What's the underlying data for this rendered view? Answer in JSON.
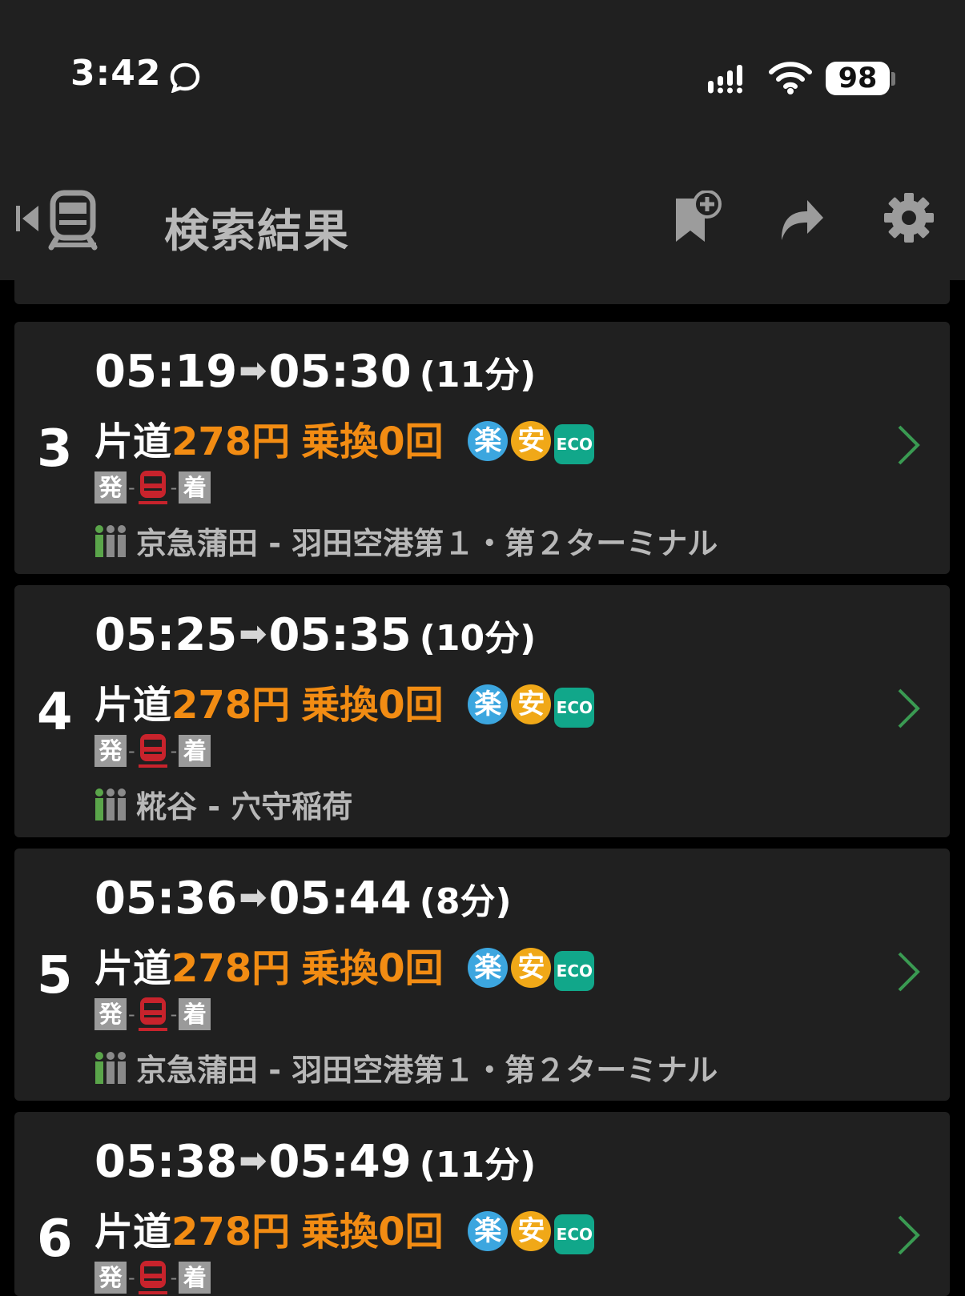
{
  "status_bar": {
    "time": "3:42",
    "battery": "98"
  },
  "header": {
    "title": "検索結果"
  },
  "routes": [
    {
      "number": "3",
      "depart": "05:19",
      "arrive": "05:30",
      "duration": "(11分)",
      "fare_label": "片道",
      "fare": "278円",
      "transfers": "乗換0回",
      "badge_raku": "楽",
      "badge_an": "安",
      "badge_eco": "ECO",
      "leg_depart": "発",
      "leg_arrive": "着",
      "line": "京急蒲田 - 羽田空港第１・第２ターミナル"
    },
    {
      "number": "4",
      "depart": "05:25",
      "arrive": "05:35",
      "duration": "(10分)",
      "fare_label": "片道",
      "fare": "278円",
      "transfers": "乗換0回",
      "badge_raku": "楽",
      "badge_an": "安",
      "badge_eco": "ECO",
      "leg_depart": "発",
      "leg_arrive": "着",
      "line": "糀谷 - 穴守稲荷"
    },
    {
      "number": "5",
      "depart": "05:36",
      "arrive": "05:44",
      "duration": "(8分)",
      "fare_label": "片道",
      "fare": "278円",
      "transfers": "乗換0回",
      "badge_raku": "楽",
      "badge_an": "安",
      "badge_eco": "ECO",
      "leg_depart": "発",
      "leg_arrive": "着",
      "line": "京急蒲田 - 羽田空港第１・第２ターミナル"
    },
    {
      "number": "6",
      "depart": "05:38",
      "arrive": "05:49",
      "duration": "(11分)",
      "fare_label": "片道",
      "fare": "278円",
      "transfers": "乗換0回",
      "badge_raku": "楽",
      "badge_an": "安",
      "badge_eco": "ECO",
      "leg_depart": "発",
      "leg_arrive": "着",
      "line": ""
    }
  ],
  "colors": {
    "background": "#000000",
    "card": "#202020",
    "accent_orange": "#f28c13",
    "raku_blue": "#3ca6df",
    "an_yellow": "#f0a818",
    "eco_green": "#11a78a",
    "train_red": "#c8232c",
    "chevron_green": "#3a9a52"
  },
  "icons": [
    "chat-icon",
    "signal-icon",
    "wifi-icon",
    "battery-icon",
    "back-icon",
    "train-icon",
    "bookmark-add-icon",
    "share-icon",
    "gear-icon",
    "train-icon",
    "people-icon",
    "chevron-right-icon"
  ]
}
